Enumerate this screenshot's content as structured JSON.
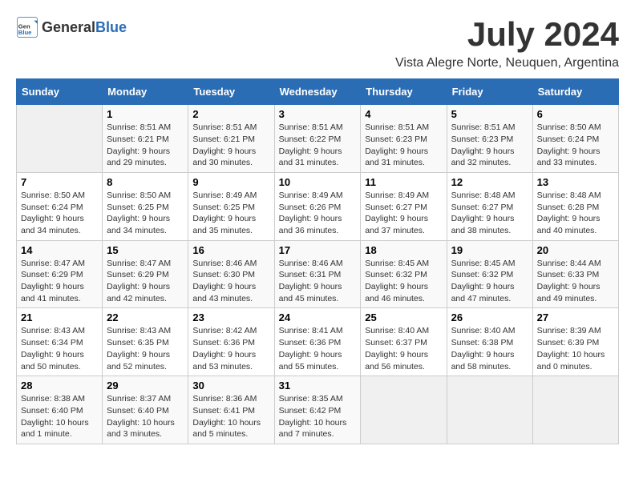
{
  "header": {
    "logo_general": "General",
    "logo_blue": "Blue",
    "month_year": "July 2024",
    "location": "Vista Alegre Norte, Neuquen, Argentina"
  },
  "columns": [
    "Sunday",
    "Monday",
    "Tuesday",
    "Wednesday",
    "Thursday",
    "Friday",
    "Saturday"
  ],
  "weeks": [
    [
      {
        "day": "",
        "sunrise": "",
        "sunset": "",
        "daylight": ""
      },
      {
        "day": "1",
        "sunrise": "Sunrise: 8:51 AM",
        "sunset": "Sunset: 6:21 PM",
        "daylight": "Daylight: 9 hours and 29 minutes."
      },
      {
        "day": "2",
        "sunrise": "Sunrise: 8:51 AM",
        "sunset": "Sunset: 6:21 PM",
        "daylight": "Daylight: 9 hours and 30 minutes."
      },
      {
        "day": "3",
        "sunrise": "Sunrise: 8:51 AM",
        "sunset": "Sunset: 6:22 PM",
        "daylight": "Daylight: 9 hours and 31 minutes."
      },
      {
        "day": "4",
        "sunrise": "Sunrise: 8:51 AM",
        "sunset": "Sunset: 6:23 PM",
        "daylight": "Daylight: 9 hours and 31 minutes."
      },
      {
        "day": "5",
        "sunrise": "Sunrise: 8:51 AM",
        "sunset": "Sunset: 6:23 PM",
        "daylight": "Daylight: 9 hours and 32 minutes."
      },
      {
        "day": "6",
        "sunrise": "Sunrise: 8:50 AM",
        "sunset": "Sunset: 6:24 PM",
        "daylight": "Daylight: 9 hours and 33 minutes."
      }
    ],
    [
      {
        "day": "7",
        "sunrise": "Sunrise: 8:50 AM",
        "sunset": "Sunset: 6:24 PM",
        "daylight": "Daylight: 9 hours and 34 minutes."
      },
      {
        "day": "8",
        "sunrise": "Sunrise: 8:50 AM",
        "sunset": "Sunset: 6:25 PM",
        "daylight": "Daylight: 9 hours and 34 minutes."
      },
      {
        "day": "9",
        "sunrise": "Sunrise: 8:49 AM",
        "sunset": "Sunset: 6:25 PM",
        "daylight": "Daylight: 9 hours and 35 minutes."
      },
      {
        "day": "10",
        "sunrise": "Sunrise: 8:49 AM",
        "sunset": "Sunset: 6:26 PM",
        "daylight": "Daylight: 9 hours and 36 minutes."
      },
      {
        "day": "11",
        "sunrise": "Sunrise: 8:49 AM",
        "sunset": "Sunset: 6:27 PM",
        "daylight": "Daylight: 9 hours and 37 minutes."
      },
      {
        "day": "12",
        "sunrise": "Sunrise: 8:48 AM",
        "sunset": "Sunset: 6:27 PM",
        "daylight": "Daylight: 9 hours and 38 minutes."
      },
      {
        "day": "13",
        "sunrise": "Sunrise: 8:48 AM",
        "sunset": "Sunset: 6:28 PM",
        "daylight": "Daylight: 9 hours and 40 minutes."
      }
    ],
    [
      {
        "day": "14",
        "sunrise": "Sunrise: 8:47 AM",
        "sunset": "Sunset: 6:29 PM",
        "daylight": "Daylight: 9 hours and 41 minutes."
      },
      {
        "day": "15",
        "sunrise": "Sunrise: 8:47 AM",
        "sunset": "Sunset: 6:29 PM",
        "daylight": "Daylight: 9 hours and 42 minutes."
      },
      {
        "day": "16",
        "sunrise": "Sunrise: 8:46 AM",
        "sunset": "Sunset: 6:30 PM",
        "daylight": "Daylight: 9 hours and 43 minutes."
      },
      {
        "day": "17",
        "sunrise": "Sunrise: 8:46 AM",
        "sunset": "Sunset: 6:31 PM",
        "daylight": "Daylight: 9 hours and 45 minutes."
      },
      {
        "day": "18",
        "sunrise": "Sunrise: 8:45 AM",
        "sunset": "Sunset: 6:32 PM",
        "daylight": "Daylight: 9 hours and 46 minutes."
      },
      {
        "day": "19",
        "sunrise": "Sunrise: 8:45 AM",
        "sunset": "Sunset: 6:32 PM",
        "daylight": "Daylight: 9 hours and 47 minutes."
      },
      {
        "day": "20",
        "sunrise": "Sunrise: 8:44 AM",
        "sunset": "Sunset: 6:33 PM",
        "daylight": "Daylight: 9 hours and 49 minutes."
      }
    ],
    [
      {
        "day": "21",
        "sunrise": "Sunrise: 8:43 AM",
        "sunset": "Sunset: 6:34 PM",
        "daylight": "Daylight: 9 hours and 50 minutes."
      },
      {
        "day": "22",
        "sunrise": "Sunrise: 8:43 AM",
        "sunset": "Sunset: 6:35 PM",
        "daylight": "Daylight: 9 hours and 52 minutes."
      },
      {
        "day": "23",
        "sunrise": "Sunrise: 8:42 AM",
        "sunset": "Sunset: 6:36 PM",
        "daylight": "Daylight: 9 hours and 53 minutes."
      },
      {
        "day": "24",
        "sunrise": "Sunrise: 8:41 AM",
        "sunset": "Sunset: 6:36 PM",
        "daylight": "Daylight: 9 hours and 55 minutes."
      },
      {
        "day": "25",
        "sunrise": "Sunrise: 8:40 AM",
        "sunset": "Sunset: 6:37 PM",
        "daylight": "Daylight: 9 hours and 56 minutes."
      },
      {
        "day": "26",
        "sunrise": "Sunrise: 8:40 AM",
        "sunset": "Sunset: 6:38 PM",
        "daylight": "Daylight: 9 hours and 58 minutes."
      },
      {
        "day": "27",
        "sunrise": "Sunrise: 8:39 AM",
        "sunset": "Sunset: 6:39 PM",
        "daylight": "Daylight: 10 hours and 0 minutes."
      }
    ],
    [
      {
        "day": "28",
        "sunrise": "Sunrise: 8:38 AM",
        "sunset": "Sunset: 6:40 PM",
        "daylight": "Daylight: 10 hours and 1 minute."
      },
      {
        "day": "29",
        "sunrise": "Sunrise: 8:37 AM",
        "sunset": "Sunset: 6:40 PM",
        "daylight": "Daylight: 10 hours and 3 minutes."
      },
      {
        "day": "30",
        "sunrise": "Sunrise: 8:36 AM",
        "sunset": "Sunset: 6:41 PM",
        "daylight": "Daylight: 10 hours and 5 minutes."
      },
      {
        "day": "31",
        "sunrise": "Sunrise: 8:35 AM",
        "sunset": "Sunset: 6:42 PM",
        "daylight": "Daylight: 10 hours and 7 minutes."
      },
      {
        "day": "",
        "sunrise": "",
        "sunset": "",
        "daylight": ""
      },
      {
        "day": "",
        "sunrise": "",
        "sunset": "",
        "daylight": ""
      },
      {
        "day": "",
        "sunrise": "",
        "sunset": "",
        "daylight": ""
      }
    ]
  ]
}
